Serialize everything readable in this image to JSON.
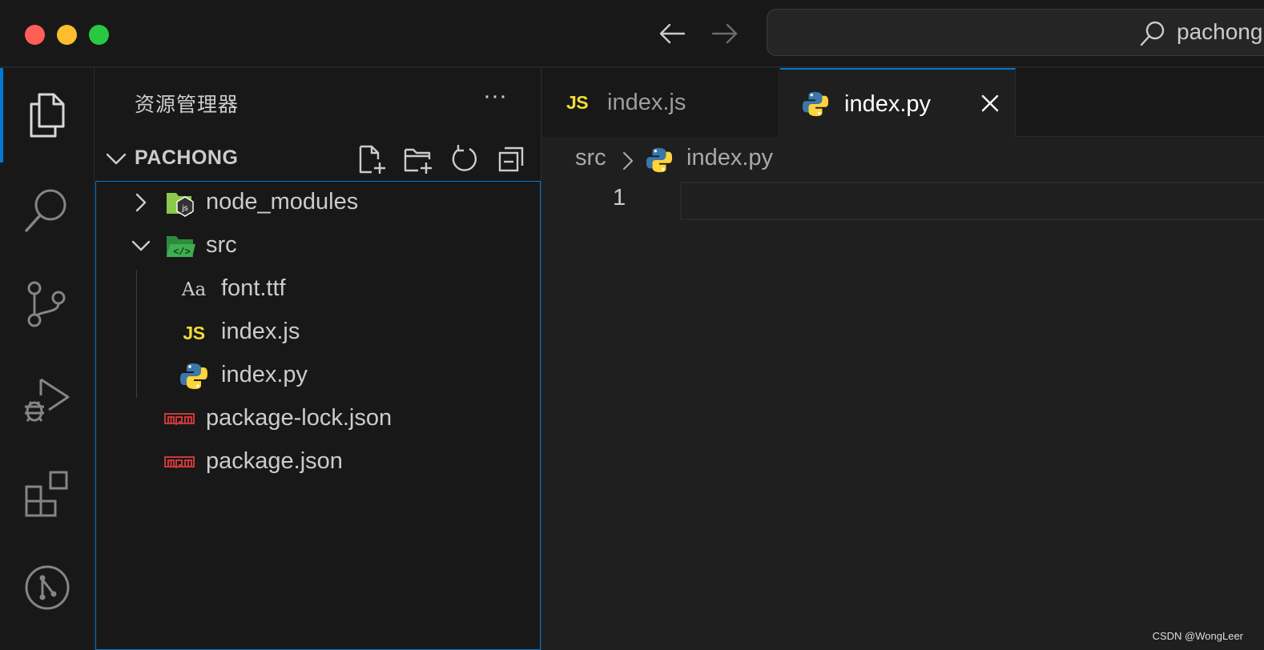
{
  "titlebar": {
    "command_center_text": "pachong"
  },
  "sidebar": {
    "title": "资源管理器",
    "more_label": "···",
    "folder_name": "PACHONG",
    "tree": [
      {
        "label": "node_modules",
        "icon": "node-modules-folder-icon",
        "expanded": false
      },
      {
        "label": "src",
        "icon": "src-folder-icon",
        "expanded": true
      },
      {
        "label": "font.ttf",
        "icon": "font-file-icon",
        "icon_text": "Aa"
      },
      {
        "label": "index.js",
        "icon": "javascript-file-icon",
        "icon_text": "JS"
      },
      {
        "label": "index.py",
        "icon": "python-file-icon"
      },
      {
        "label": "package-lock.json",
        "icon": "npm-file-icon"
      },
      {
        "label": "package.json",
        "icon": "npm-file-icon"
      }
    ]
  },
  "editor": {
    "tabs": [
      {
        "label": "index.js",
        "icon_text": "JS",
        "active": false
      },
      {
        "label": "index.py",
        "active": true
      }
    ],
    "breadcrumb": [
      "src",
      "index.py"
    ],
    "line_numbers": [
      "1"
    ]
  },
  "watermark": "CSDN @WongLeer",
  "colors": {
    "accent": "#0078d4",
    "js_yellow": "#f1dd35",
    "python_blue": "#3b77a8",
    "python_yellow": "#ffd43b",
    "npm_red": "#cb3837",
    "node_green": "#8cc84b"
  }
}
